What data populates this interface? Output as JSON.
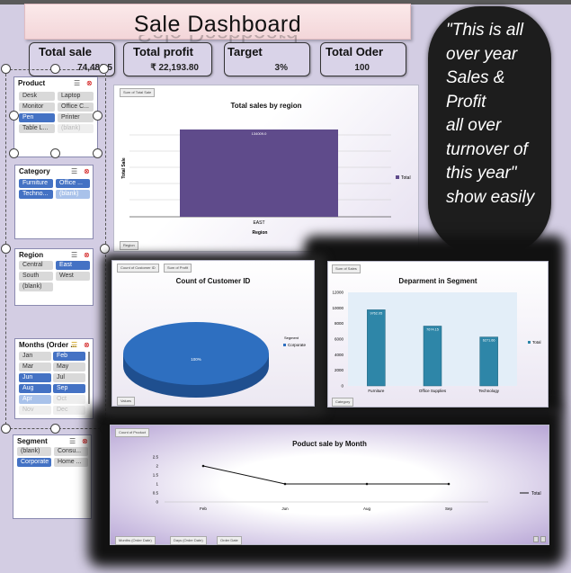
{
  "title": "Sale Dashboard",
  "kpis": [
    {
      "label": "Total sale",
      "value": "74,486.5"
    },
    {
      "label": "Total profit",
      "value": "₹ 22,193.80"
    },
    {
      "label": "Target",
      "value": "3%"
    },
    {
      "label": "Total Oder",
      "value": "100"
    }
  ],
  "note": "\"This is all\nover year\nSales &\nProfit\nall over\nturnover of\nthis year\"\nshow easily",
  "slicers": {
    "product": {
      "title": "Product",
      "items": [
        {
          "label": "Desk",
          "state": "off"
        },
        {
          "label": "Laptop",
          "state": "off"
        },
        {
          "label": "Monitor",
          "state": "off"
        },
        {
          "label": "Office C...",
          "state": "off"
        },
        {
          "label": "Pen",
          "state": "on"
        },
        {
          "label": "Printer",
          "state": "off"
        },
        {
          "label": "Table L...",
          "state": "off"
        },
        {
          "label": "(blank)",
          "state": "dim"
        }
      ]
    },
    "category": {
      "title": "Category",
      "items": [
        {
          "label": "Furniture",
          "state": "on"
        },
        {
          "label": "Office ...",
          "state": "on"
        },
        {
          "label": "Techno...",
          "state": "on"
        },
        {
          "label": "(blank)",
          "state": "dimon"
        }
      ]
    },
    "region": {
      "title": "Region",
      "items": [
        {
          "label": "Central",
          "state": "off"
        },
        {
          "label": "East",
          "state": "on"
        },
        {
          "label": "South",
          "state": "off"
        },
        {
          "label": "West",
          "state": "off"
        },
        {
          "label": "(blank)",
          "state": "off"
        }
      ]
    },
    "months": {
      "title": "Months (Order ...",
      "items": [
        {
          "label": "Jan",
          "state": "off"
        },
        {
          "label": "Feb",
          "state": "on"
        },
        {
          "label": "Mar",
          "state": "off"
        },
        {
          "label": "May",
          "state": "off"
        },
        {
          "label": "Jun",
          "state": "on"
        },
        {
          "label": "Jul",
          "state": "off"
        },
        {
          "label": "Aug",
          "state": "on"
        },
        {
          "label": "Sep",
          "state": "on"
        },
        {
          "label": "Apr",
          "state": "dimon"
        },
        {
          "label": "Oct",
          "state": "dim"
        },
        {
          "label": "Nov",
          "state": "dim"
        },
        {
          "label": "Dec",
          "state": "dim"
        }
      ]
    },
    "segment": {
      "title": "Segment",
      "items": [
        {
          "label": "(blank)",
          "state": "off"
        },
        {
          "label": "Consu...",
          "state": "off"
        },
        {
          "label": "Corporate",
          "state": "on"
        },
        {
          "label": "Home ...",
          "state": "off"
        }
      ]
    }
  },
  "charts": {
    "region": {
      "field": "Sum of Total Sale",
      "title": "Total sales by region",
      "ylabel": "Total Sale",
      "xlabel": "Region",
      "legend": "Total",
      "filter": "Region"
    },
    "customer": {
      "fields": [
        "Count of Customer ID",
        "Sum of Profit"
      ],
      "title": "Count of Customer ID",
      "legend_title": "Segment",
      "legend": "Corporate",
      "value_label": "100%",
      "filter": "Values"
    },
    "segment": {
      "field": "Sum of Sales",
      "title": "Deparment in Segment",
      "legend": "Total",
      "filter": "Category"
    },
    "month": {
      "field": "Count of Product",
      "title": "Poduct sale by Month",
      "legend": "Total",
      "filters": [
        "Months (Order Date)",
        "Days (Order Date)",
        "Order Date"
      ]
    }
  },
  "chart_data": [
    {
      "type": "bar",
      "title": "Total sales by region",
      "categories": [
        "EAST"
      ],
      "series": [
        {
          "name": "Total",
          "values": [
            134009.0
          ]
        }
      ],
      "data_labels": [
        "134009.0"
      ],
      "xlabel": "Region",
      "ylabel": "Total Sale"
    },
    {
      "type": "pie",
      "title": "Count of Customer ID",
      "categories": [
        "Corporate"
      ],
      "values": [
        100
      ],
      "data_labels": [
        "100%"
      ]
    },
    {
      "type": "bar",
      "title": "Deparment in Segment",
      "categories": [
        "Furniture",
        "Office Supplies",
        "Technology"
      ],
      "series": [
        {
          "name": "Total",
          "values": [
            9762.05,
            7674.15,
            6271.66
          ]
        }
      ],
      "data_labels": [
        "9762.05",
        "7674.15",
        "6271.66"
      ],
      "yticks": [
        "0",
        "2000",
        "4000",
        "6000",
        "8000",
        "10000",
        "12000"
      ],
      "ylim": [
        0,
        12000
      ]
    },
    {
      "type": "line",
      "title": "Poduct sale by Month",
      "categories": [
        "Feb",
        "Jun",
        "Aug",
        "Sep"
      ],
      "series": [
        {
          "name": "Total",
          "values": [
            2,
            1,
            1,
            1
          ]
        }
      ],
      "yticks": [
        "0",
        "0.5",
        "1",
        "1.5",
        "2",
        "2.5"
      ],
      "ylim": [
        0,
        2.5
      ]
    }
  ],
  "colors": {
    "slicer_on": "#4472c4",
    "bar_region": "#5f4b8b",
    "bar_segment": "#2e86a8",
    "pie": "#2e6fc0"
  }
}
